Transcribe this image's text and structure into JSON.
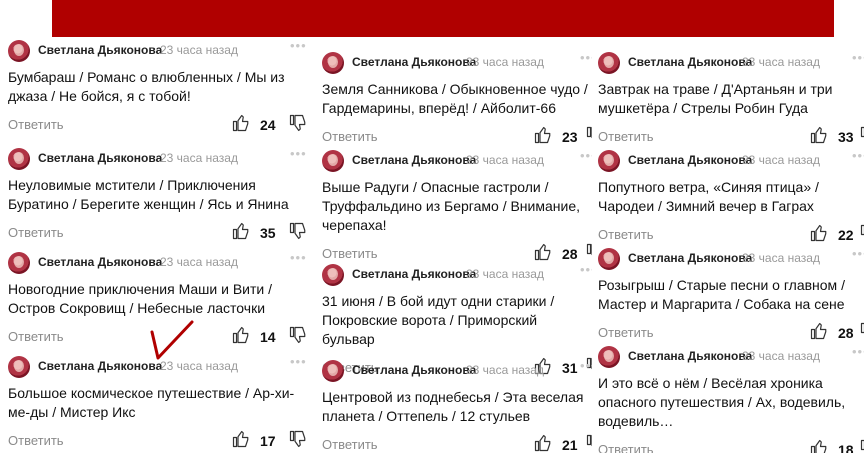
{
  "columns": [
    [
      {
        "author": "Светлана Дьяконова",
        "time": "23 часа назад",
        "text": "Бумбараш / Романс о влюбленных / Мы из джаза / Не бойся, я с тобой!",
        "reply": "Ответить",
        "likes": "24"
      },
      {
        "author": "Светлана Дьяконова",
        "time": "23 часа назад",
        "text": "Неуловимые мстители / Приключения Буратино / Берегите женщин / Ясь и Янина",
        "reply": "Ответить",
        "likes": "35"
      },
      {
        "author": "Светлана Дьяконова",
        "time": "23 часа назад",
        "text": "Новогодние приключения Маши и Вити / Остров Сокровищ / Небесные ласточки",
        "reply": "Ответить",
        "likes": "14"
      },
      {
        "author": "Светлана Дьяконова",
        "time": "23 часа назад",
        "text": "Большое космическое путешествие / Ар-хи-ме-ды / Мистер Икс",
        "reply": "Ответить",
        "likes": "17"
      }
    ],
    [
      {
        "author": "Светлана Дьяконова",
        "time": "23 часа назад",
        "text": "Земля Санникова / Обыкновенное чудо / Гардемарины, вперёд! / Айболит-66",
        "reply": "Ответить",
        "likes": "23"
      },
      {
        "author": "Светлана Дьяконова",
        "time": "23 часа назад",
        "text": "Выше Радуги / Опасные гастроли / Труффальдино из Бергамо / Внимание, черепаха!",
        "reply": "Ответить",
        "likes": "28"
      },
      {
        "author": "Светлана Дьяконова",
        "time": "23 часа назад",
        "text": "31 июня / В бой идут одни старики / Покровские ворота / Приморский бульвар",
        "reply": "Ответить",
        "likes": "31"
      },
      {
        "author": "Светлана Дьяконова",
        "time": "23 часа назад",
        "text": "Центровой из поднебесья / Эта веселая планета / Оттепель / 12 стульев",
        "reply": "Ответить",
        "likes": "21"
      }
    ],
    [
      {
        "author": "Светлана Дьяконова",
        "time": "23 часа назад",
        "text": "Завтрак на траве / Д'Артаньян и три мушкетёра / Стрелы Робин Гуда",
        "reply": "Ответить",
        "likes": "33"
      },
      {
        "author": "Светлана Дьяконова",
        "time": "23 часа назад",
        "text": "Попутного ветра, «Синяя птица» / Чародеи / Зимний вечер в Гаграх",
        "reply": "Ответить",
        "likes": "22"
      },
      {
        "author": "Светлана Дьяконова",
        "time": "23 часа назад",
        "text": "Розыгрыш / Старые песни о главном / Мастер и Маргарита / Собака на сене",
        "reply": "Ответить",
        "likes": "28"
      },
      {
        "author": "Светлана Дьяконова",
        "time": "23 часа назад",
        "text": "И это всё о нём / Весёлая хроника опасного путешествия / Ах, водевиль, водевиль…",
        "reply": "Ответить",
        "likes": "18"
      }
    ]
  ],
  "colors": {
    "banner": "#b00000",
    "accent": "#b03344"
  },
  "icons": [
    "like-icon",
    "dislike-icon",
    "more-icon",
    "avatar"
  ]
}
